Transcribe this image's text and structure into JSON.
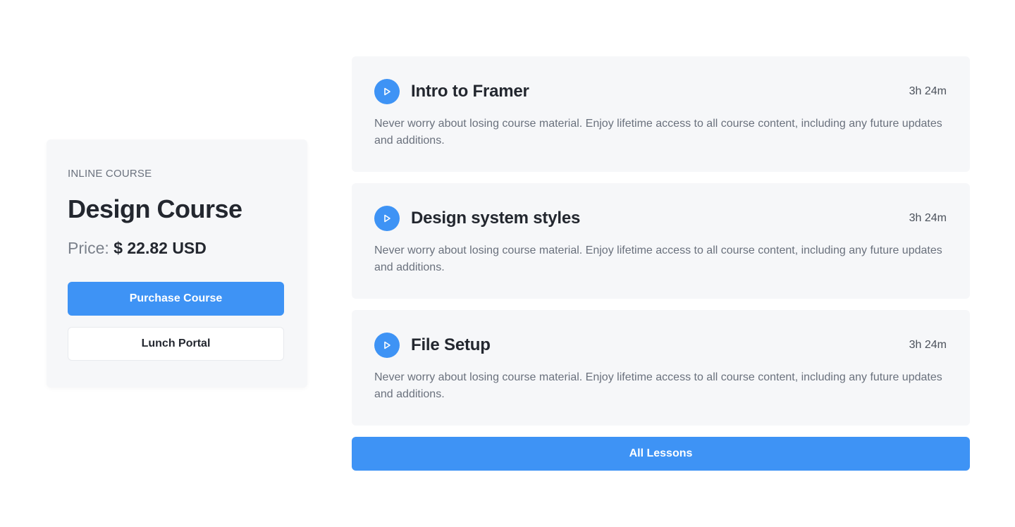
{
  "course": {
    "eyebrow": "INLINE COURSE",
    "title": "Design Course",
    "price_label": "Price:",
    "price_value": "$ 22.82 USD",
    "purchase_label": "Purchase Course",
    "portal_label": "Lunch Portal"
  },
  "lessons": [
    {
      "title": "Intro to Framer",
      "duration": "3h 24m",
      "description": "Never worry about losing course material. Enjoy lifetime access to all course content, including any future updates and additions.",
      "icon": "play-icon"
    },
    {
      "title": "Design system styles",
      "duration": "3h 24m",
      "description": "Never worry about losing course material. Enjoy lifetime access to all course content, including any future updates and additions.",
      "icon": "play-icon"
    },
    {
      "title": "File Setup",
      "duration": "3h 24m",
      "description": "Never worry about losing course material. Enjoy lifetime access to all course content, including any future updates and additions.",
      "icon": "play-icon"
    }
  ],
  "all_lessons_label": "All Lessons",
  "colors": {
    "accent": "#3e93f5",
    "card_bg": "#f6f7f9",
    "text_dark": "#23272f",
    "text_muted": "#6a717d"
  }
}
